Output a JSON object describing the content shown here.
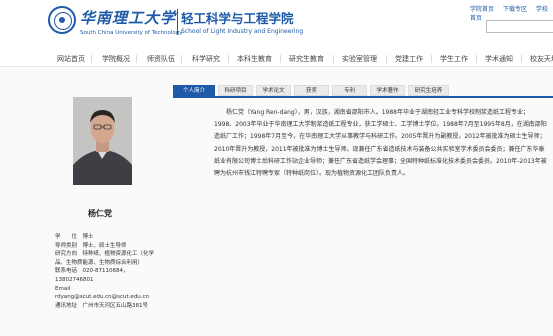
{
  "header": {
    "university_cn": "华南理工大学",
    "university_en": "South China University of Technology",
    "school_cn": "轻工科学与工程学院",
    "school_en": "School of Light Industry and Engineering",
    "top_links": [
      "学院首页",
      "下载专区",
      "学校首页"
    ]
  },
  "nav": {
    "items": [
      "网站首页",
      "学院概况",
      "师资队伍",
      "科学研究",
      "本科生教育",
      "研究生教育",
      "实验室管理",
      "党建工作",
      "学生工作",
      "学术通知",
      "校友天地"
    ]
  },
  "tabs": [
    "个人简介",
    "科研项目",
    "学术论文",
    "获奖",
    "专利",
    "学术著作",
    "研究生培养"
  ],
  "active_tab": "个人简介",
  "profile": {
    "name": "杨仁党",
    "info_lines": [
      "学　　位　博士",
      "导师类别　博士、硕士生导师",
      "研究方向　特种纸、植物资源化工（化学",
      "品、生物质能源、生物质综合利用）",
      "联系电话　020-87110684，",
      "13802746801",
      "Email",
      "rdyang@scut.edu.cn@scut.edu.cn",
      "通讯地址　广州市天河区五山路381号"
    ]
  },
  "bio": {
    "text": "杨仁党（Yang Ren-dang），男，汉族，湖南省邵阳市人。1988年毕业于湖南轻工业专科学校制浆造纸工程专业；1998、2003年毕业于华南理工大学制浆造纸工程专业，获工学硕士、工学博士学位。1988年7月至1995年8月，在湖南邵阳造纸厂工作；1998年7月至今，在华南理工大学从事教学与科研工作。2005年晋升为副教授，2012年被批准为硕士生导师；2010年晋升为教授，2011年被批准为博士生导师。现兼任广东省造纸技术与装备公共实验室学术委员会委员；兼任广东华泰纸业有限公司博士后科研工作站企业导师；兼任广东省造纸学会理事；全国特种纸标准化技术委员会委员。2010年-2013年被聘为杭州市钱江特聘专家（特种纸岗位）。现为植物资源化工团队负责人。"
  }
}
